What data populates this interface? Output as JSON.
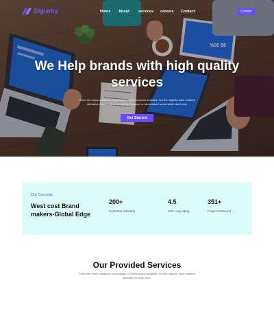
{
  "brand": {
    "name": "Digiwhy",
    "accent": "#6a4cf5"
  },
  "nav": {
    "links": [
      "Home",
      "About",
      "services",
      "careers",
      "Contact"
    ],
    "contact_button": "Contact"
  },
  "hero": {
    "title": "We Help brands with high quality services",
    "subtitle": "There are many variations of passages of Lorem Ipsum available, but the majority have suffered alteration in some form, by injected humour, or randomised words which don't look",
    "cta_label": "Get Started"
  },
  "stats": {
    "eyebrow": "Our Success",
    "heading": "West cost Brand makers-Global Edge",
    "items": [
      {
        "value": "200+",
        "label": "Customer Satisfied"
      },
      {
        "value": "4.5",
        "label": "200+ Avg rating"
      },
      {
        "value": "351+",
        "label": "Project Delivered"
      }
    ],
    "background": "#dafdf7"
  },
  "services": {
    "title": "Our Provided Services",
    "description": "There are many variations of passages of Lorem Ipsum available, but the majority have suffered alteration in some form."
  }
}
